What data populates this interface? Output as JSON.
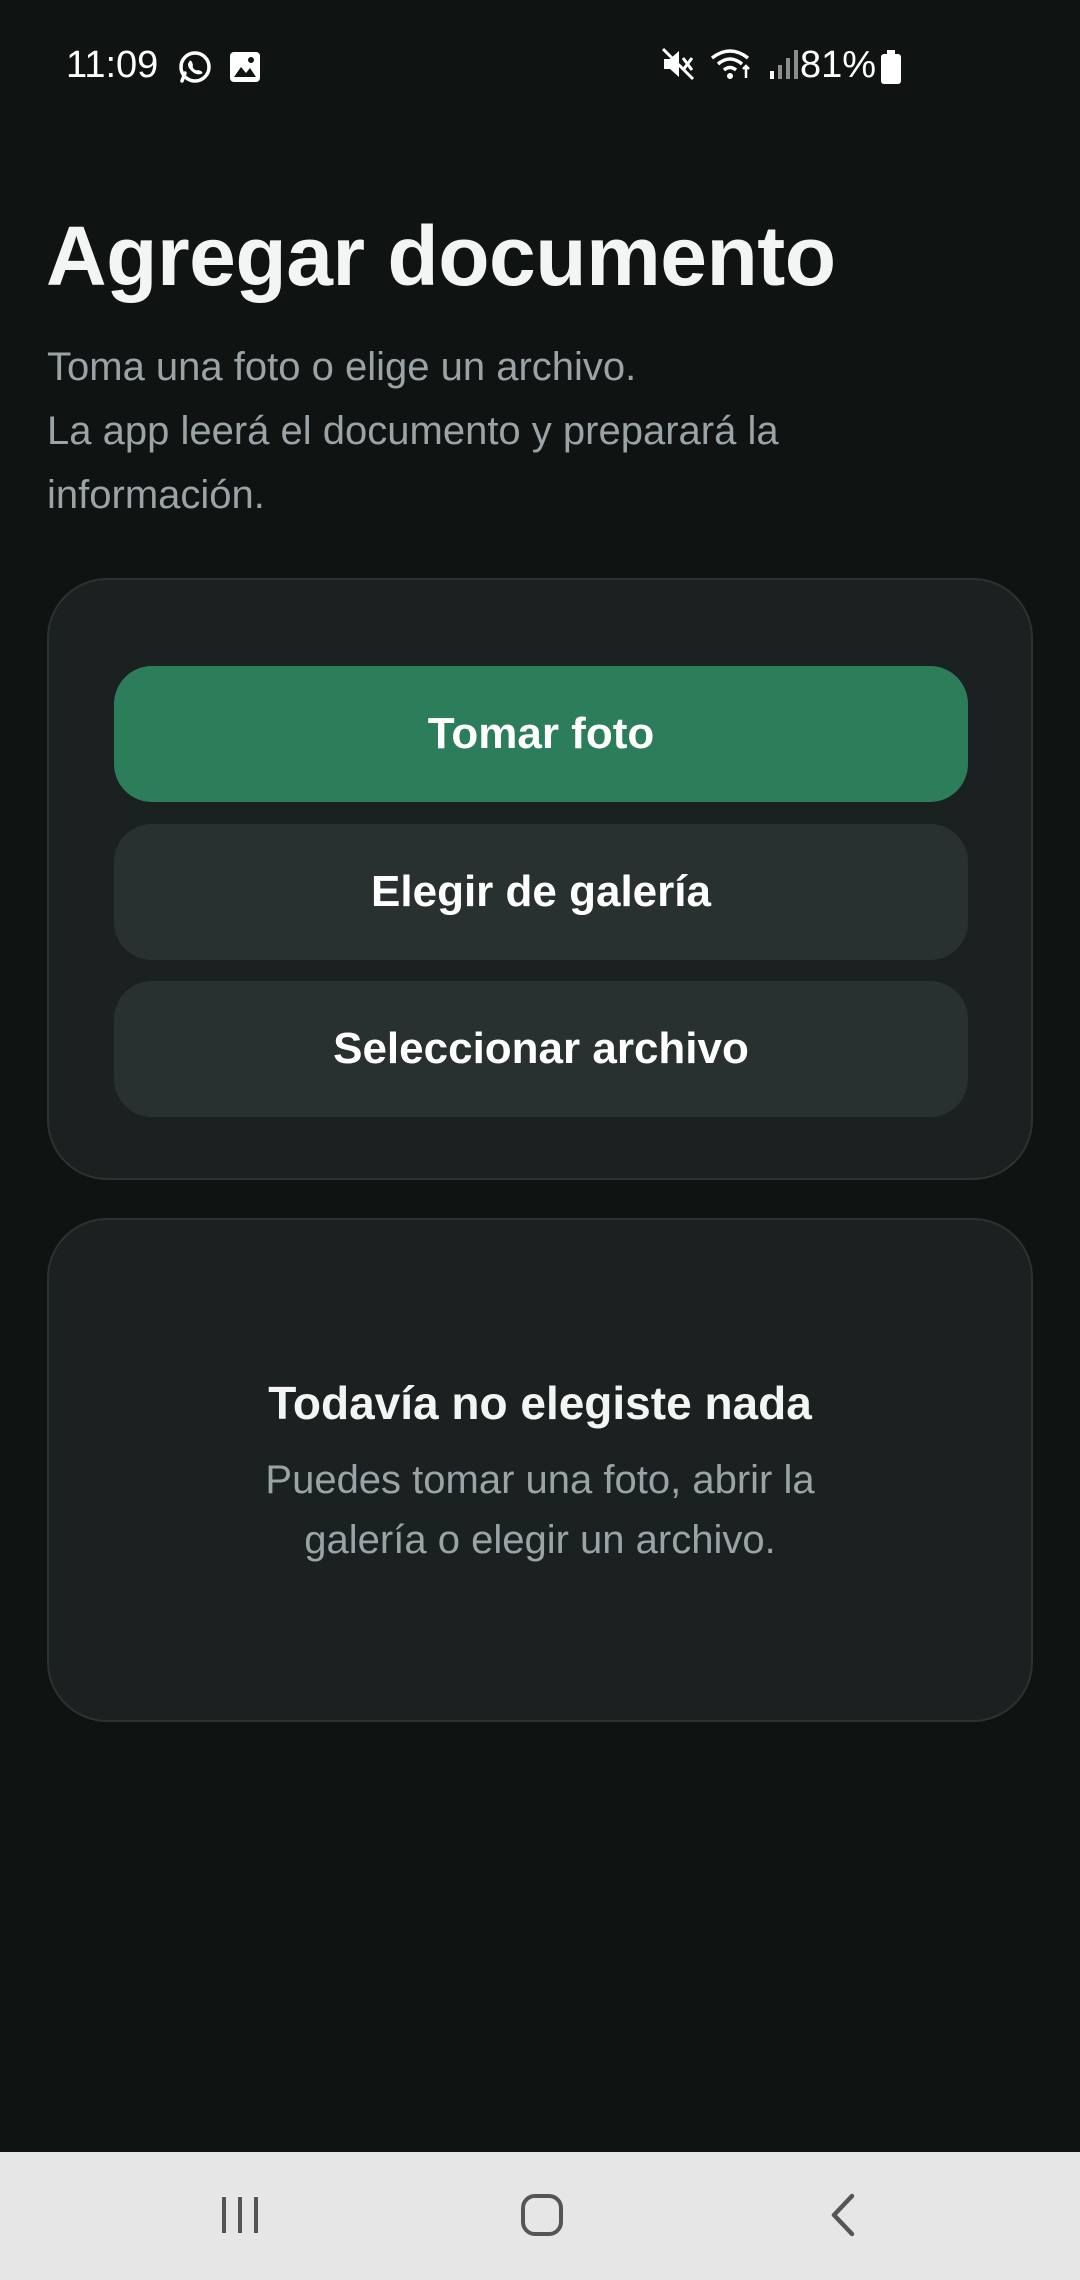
{
  "status_bar": {
    "time": "11:09",
    "left_icons": [
      "whatsapp-icon",
      "gallery-icon"
    ],
    "right_icons": [
      "mute-icon",
      "wifi-icon",
      "signal-icon"
    ],
    "battery_percent": "81%"
  },
  "header": {
    "title": "Agregar documento",
    "subtitle_lines": [
      "Toma una foto o elige un archivo.",
      "La app leerá el documento y preparará la",
      "información."
    ]
  },
  "actions": {
    "take_photo_label": "Tomar foto",
    "choose_gallery_label": "Elegir de galería",
    "select_file_label": "Seleccionar archivo"
  },
  "empty_state": {
    "title": "Todavía no elegiste nada",
    "text_lines": [
      "Puedes tomar una foto, abrir la",
      "galería o elegir un archivo."
    ]
  },
  "nav_bar": {
    "icons": [
      "recents-icon",
      "home-icon",
      "back-icon"
    ]
  },
  "colors": {
    "background": "#0f1413",
    "card": "#1b2120",
    "primary_button": "#2c7e5b",
    "secondary_button": "#283130",
    "muted_text": "#9aa3a6"
  }
}
